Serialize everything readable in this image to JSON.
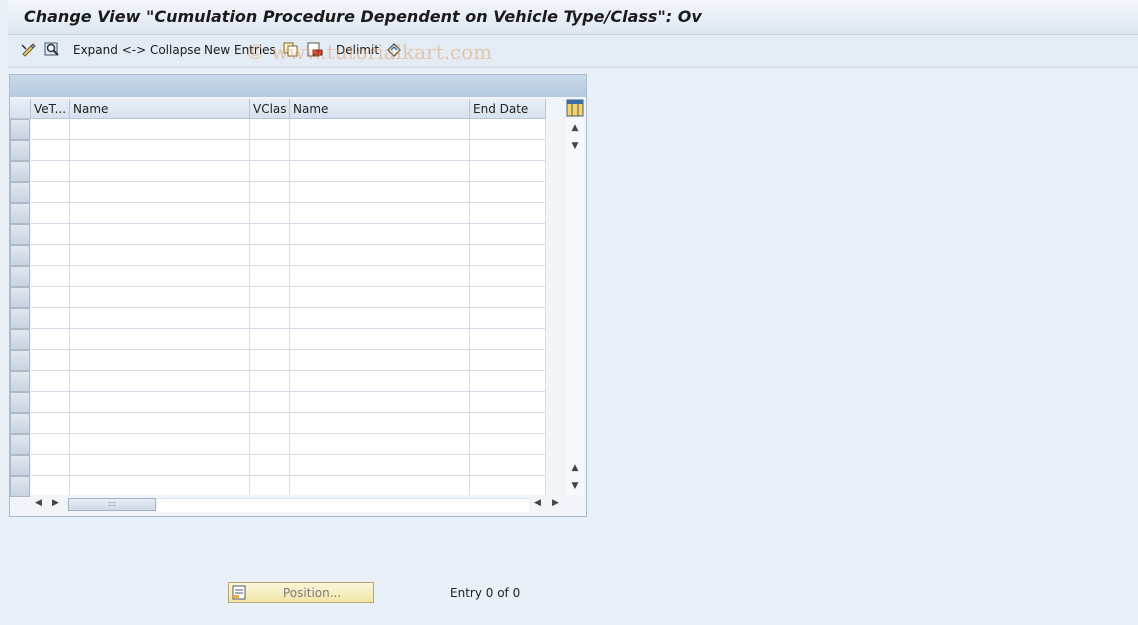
{
  "window": {
    "title": "Change View \"Cumulation Procedure Dependent on Vehicle Type/Class\": Ov"
  },
  "toolbar": {
    "expand_collapse_label": "Expand <-> Collapse",
    "new_entries_label": "New Entries",
    "delimit_label": "Delimit",
    "icons": [
      "display-change-icon",
      "find-icon",
      "copy-icon",
      "delete-icon",
      "undo-icon"
    ]
  },
  "watermark": "© www.tutorialkart.com",
  "table": {
    "columns": [
      "VeT...",
      "Name",
      "VClas",
      "Name",
      "End Date"
    ],
    "row_count": 18
  },
  "footer": {
    "position_label": "Position...",
    "entry_text": "Entry 0 of 0"
  },
  "colors": {
    "background": "#eaf0f8",
    "header_bar": "#b6cadf",
    "position_button": "#f2e6a8"
  }
}
